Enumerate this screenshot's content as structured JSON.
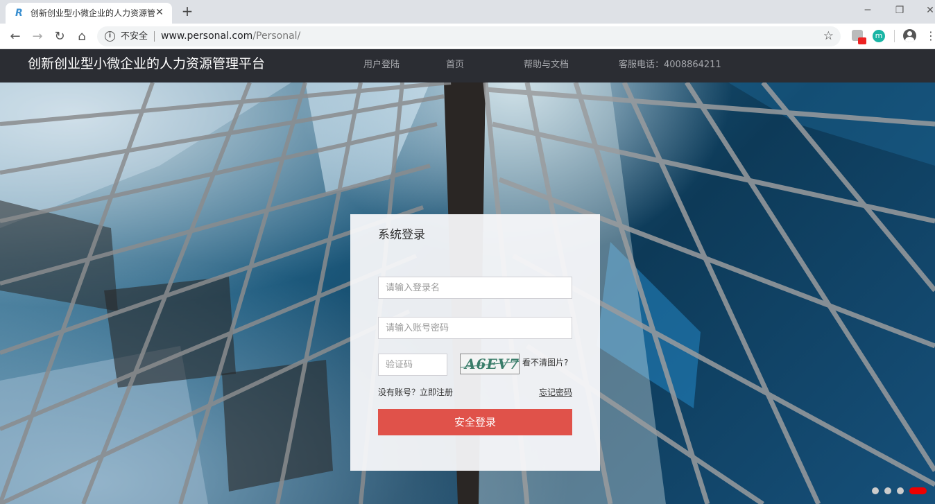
{
  "browser": {
    "tab_title": "创新创业型小微企业的人力资源管",
    "favicon": "R",
    "close_glyph": "✕",
    "newtab_glyph": "+",
    "security_label": "不安全",
    "url_host": "www.personal.com",
    "url_path": "/Personal/",
    "extension_badge": "m"
  },
  "header": {
    "title": "创新创业型小微企业的人力资源管理平台",
    "nav": {
      "login": "用户登陆",
      "home": "首页",
      "help": "帮助与文档"
    },
    "hotline": "客服电话：4008864211"
  },
  "login": {
    "title": "系统登录",
    "username_placeholder": "请输入登录名",
    "password_placeholder": "请输入账号密码",
    "captcha_placeholder": "验证码",
    "captcha_code": "A6EV7",
    "captcha_refresh": "看不清图片?",
    "register": "没有账号？立即注册",
    "forgot": "忘记密码",
    "submit": "安全登录"
  },
  "carousel": {
    "slide_count": 4,
    "active_index": 3
  },
  "colors": {
    "header_bg": "#2b2d33",
    "accent": "#e0524a",
    "active_dot": "#ee0000"
  }
}
